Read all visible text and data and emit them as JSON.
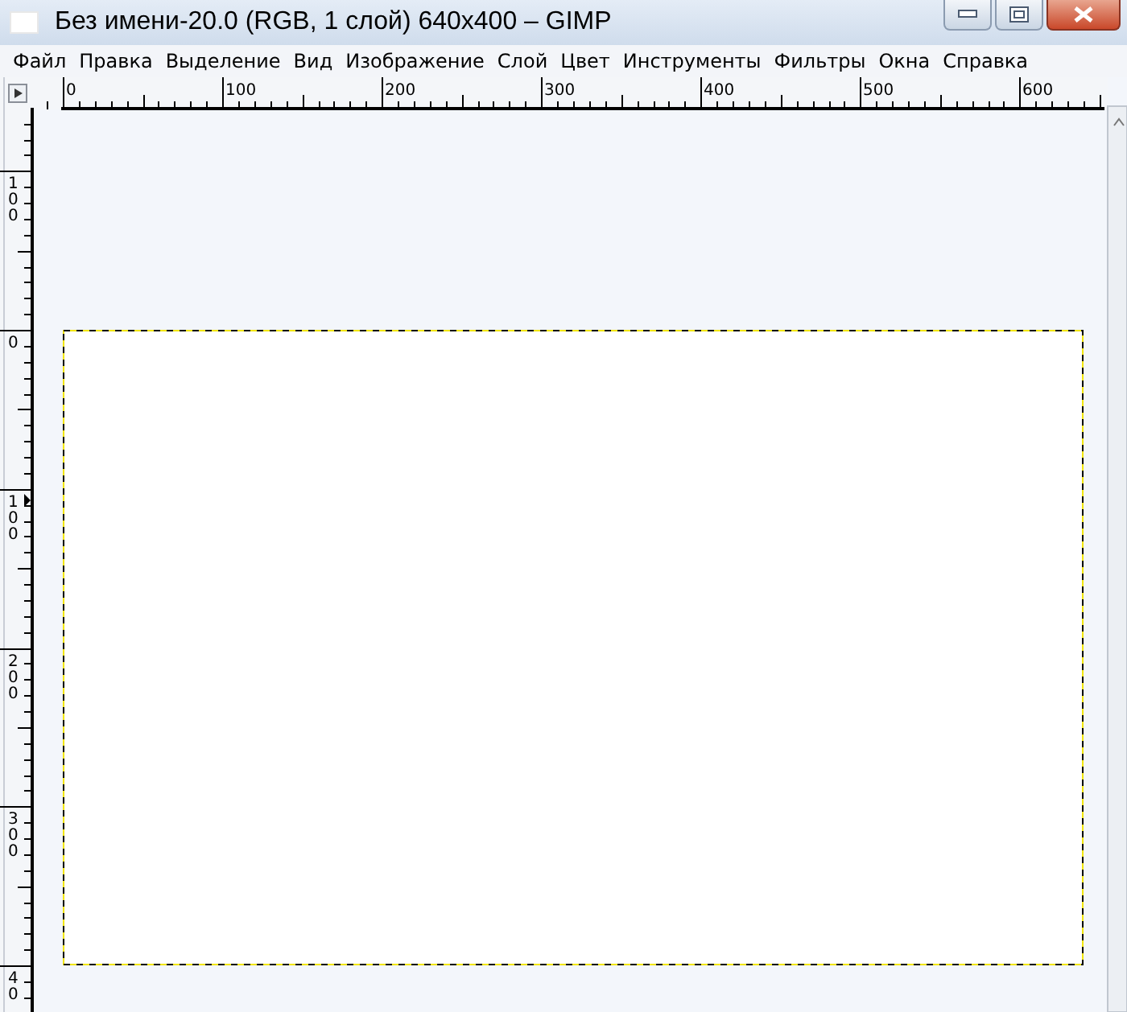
{
  "window": {
    "title": "Без имени-20.0 (RGB, 1 слой) 640x400 – GIMP"
  },
  "menu": [
    "Файл",
    "Правка",
    "Выделение",
    "Вид",
    "Изображение",
    "Слой",
    "Цвет",
    "Инструменты",
    "Фильтры",
    "Окна",
    "Справка"
  ],
  "ruler_top": {
    "labels": [
      "0",
      "100",
      "200",
      "300",
      "400",
      "500",
      "600"
    ]
  },
  "ruler_left": {
    "labels": [
      "100",
      "0",
      "100",
      "200",
      "300",
      "40"
    ]
  }
}
